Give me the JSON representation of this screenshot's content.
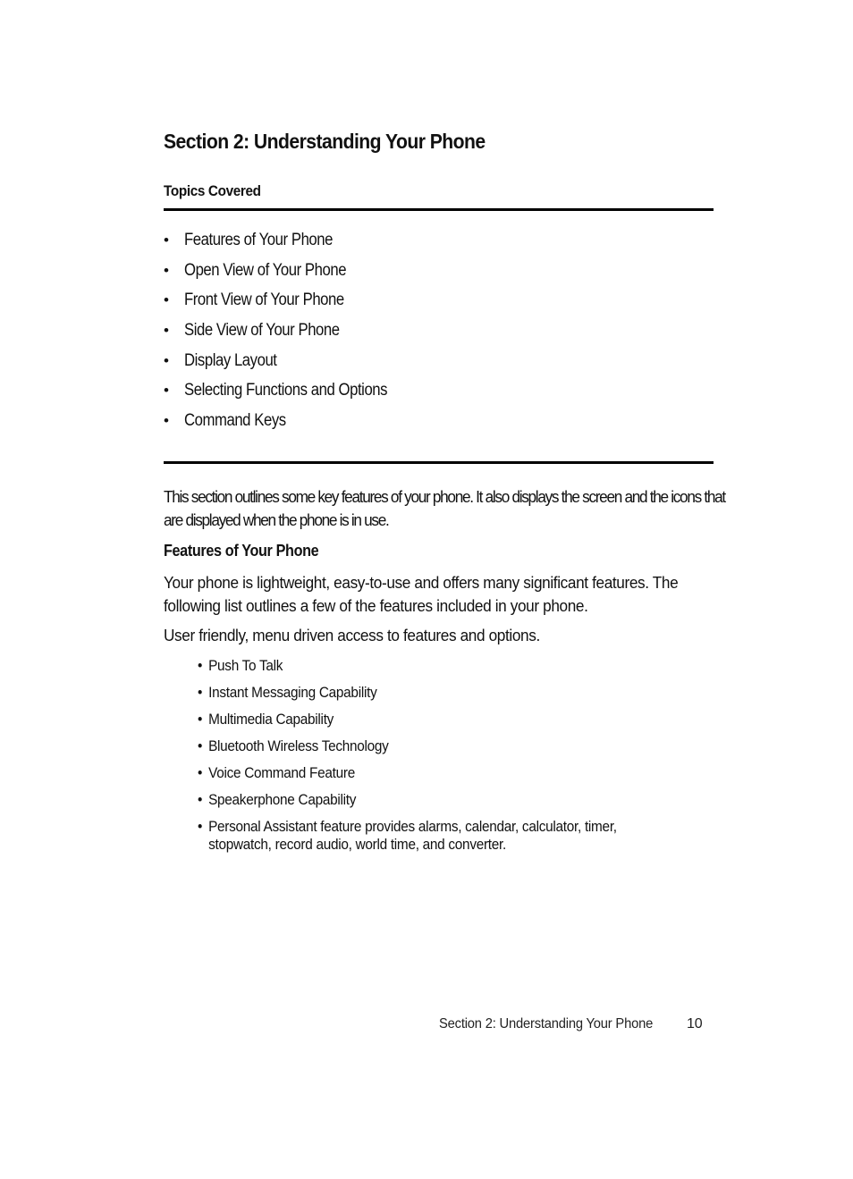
{
  "header": {
    "title": "Section 2: Understanding Your Phone",
    "topics_label": "Topics Covered"
  },
  "topics": [
    "Features of Your Phone",
    "Open View of Your Phone",
    "Front View of Your Phone",
    "Side View of Your Phone",
    "Display Layout",
    "Selecting Functions and Options",
    "Command Keys"
  ],
  "body": {
    "intro": "This section outlines some key features of your phone. It also displays the screen and the icons that are displayed when the phone is in use.",
    "features_heading": "Features of Your Phone",
    "features_para": "Your phone is lightweight, easy-to-use and offers many significant features. The following list outlines a few of the features included in your phone.",
    "features_intro": "User friendly, menu driven access to features and options."
  },
  "features": [
    "Push To Talk",
    "Instant Messaging Capability",
    "Multimedia Capability",
    "Bluetooth Wireless Technology",
    "Voice Command Feature",
    "Speakerphone Capability",
    "Personal Assistant feature provides alarms, calendar, calculator, timer, stopwatch, record audio, world time, and converter."
  ],
  "bullet_glyph": "•",
  "footer": {
    "section": "Section 2: Understanding Your Phone",
    "page_number": "10"
  }
}
